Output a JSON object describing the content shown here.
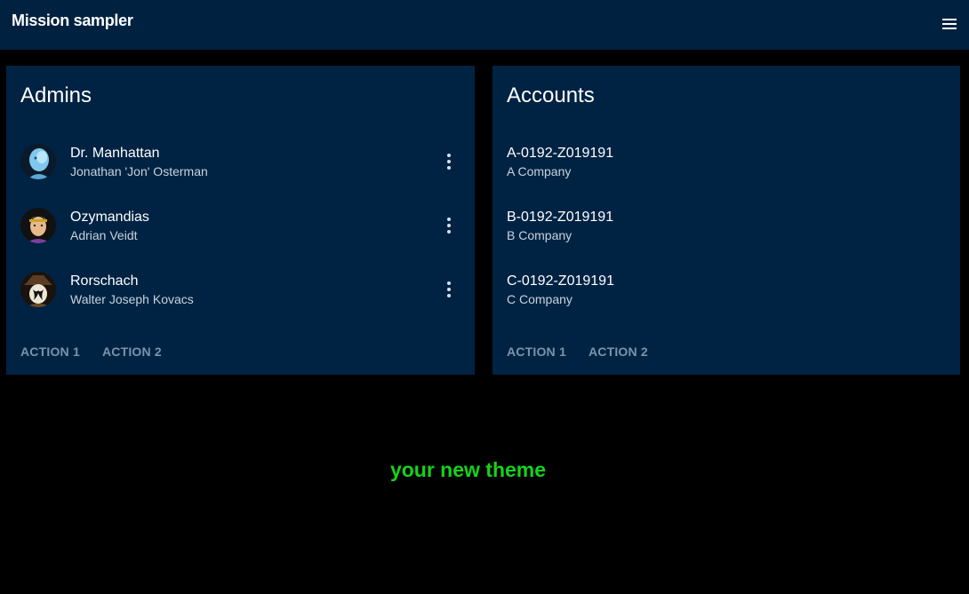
{
  "app": {
    "title": "Mission sampler",
    "menu_icon": "menu-icon"
  },
  "admins_card": {
    "title": "Admins",
    "items": [
      {
        "name": "Dr. Manhattan",
        "subtitle": "Jonathan 'Jon' Osterman",
        "avatar": "dr-manhattan-avatar",
        "menu_icon": "more-vert-icon"
      },
      {
        "name": "Ozymandias",
        "subtitle": "Adrian Veidt",
        "avatar": "ozymandias-avatar",
        "menu_icon": "more-vert-icon"
      },
      {
        "name": "Rorschach",
        "subtitle": "Walter Joseph Kovacs",
        "avatar": "rorschach-avatar",
        "menu_icon": "more-vert-icon"
      }
    ],
    "actions": [
      "ACTION 1",
      "ACTION 2"
    ]
  },
  "accounts_card": {
    "title": "Accounts",
    "items": [
      {
        "id": "A-0192-Z019191",
        "company": "A Company"
      },
      {
        "id": "B-0192-Z019191",
        "company": "B Company"
      },
      {
        "id": "C-0192-Z019191",
        "company": "C Company"
      }
    ],
    "actions": [
      "ACTION 1",
      "ACTION 2"
    ]
  },
  "footer": {
    "theme_text": "your new theme"
  },
  "colors": {
    "background": "#000000",
    "toolbar": "#002140",
    "card": "#002343",
    "action_text": "#7a93ab",
    "theme_text": "#16d21a"
  }
}
